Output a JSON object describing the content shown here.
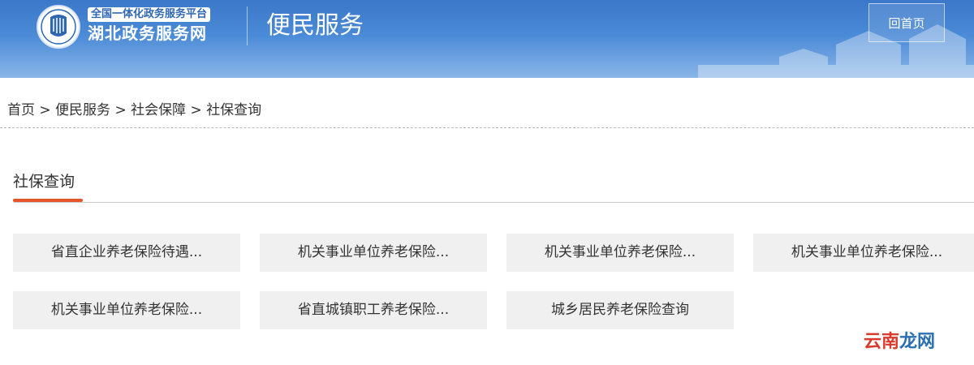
{
  "header": {
    "brand_top": "全国一体化政务服务平台",
    "brand_main": "湖北政务服务网",
    "logo_icon": "hubei-emblem-icon",
    "section_title": "便民服务",
    "home_button": "回首页"
  },
  "breadcrumb": {
    "items": [
      "首页",
      "便民服务",
      "社会保障",
      "社保查询"
    ]
  },
  "tab": {
    "title": "社保查询"
  },
  "services": [
    "省直企业养老保险待遇...",
    "机关事业单位养老保险...",
    "机关事业单位养老保险...",
    "机关事业单位养老保险...",
    "机关事业单位养老保险...",
    "省直城镇职工养老保险...",
    "城乡居民养老保险查询"
  ],
  "watermark": {
    "part1": "云",
    "part2": "南",
    "part3": "龙",
    "part4": "网"
  },
  "colors": {
    "header_blue": "#3b78c9",
    "accent_orange": "#e4562a",
    "button_bg": "#f0f0f0"
  }
}
